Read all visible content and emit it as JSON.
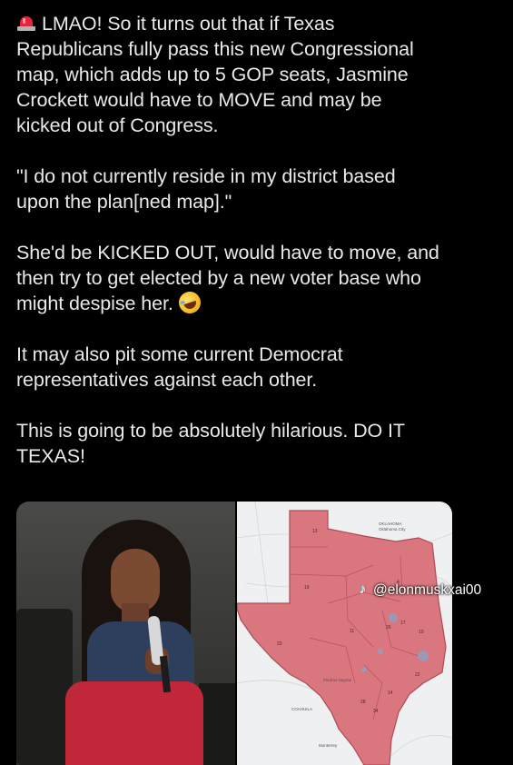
{
  "post": {
    "paragraphs": [
      "LMAO! So it turns out that if Texas Republicans fully pass this new Congressional map, which adds up to 5 GOP seats, Jasmine Crockett would have to MOVE and may be kicked out of Congress.",
      "\"I do not currently reside in my district based upon the plan[ned map].\"",
      "She'd be KICKED OUT, would have to move, and then try to get elected by a new voter base who might despise her.",
      "It may also pit some current Democrat representatives against each other.",
      "This is going to be absolutely hilarious. DO IT TEXAS!"
    ],
    "lines": {
      "p1": [
        "LMAO! So it turns out that if Texas",
        "Republicans fully pass this new Congressional",
        "map, which adds up to 5 GOP seats, Jasmine",
        "Crockett would have to MOVE and may be",
        "kicked out of Congress."
      ],
      "p2": [
        "\"I do not currently reside in my district based",
        "upon the plan[ned map].\""
      ],
      "p3": [
        "She'd be KICKED OUT, would have to move, and",
        "then try to get elected by a new voter base who",
        "might despise her."
      ],
      "p4": [
        "It may also pit some current Democrat",
        "representatives against each other."
      ],
      "p5": [
        "This is going to be absolutely hilarious. DO IT",
        "TEXAS!"
      ]
    },
    "leading_emoji": "police-light-icon",
    "trailing_emoji": "rolling-on-floor-laughing-icon"
  },
  "media": {
    "watermark": "@elonmuskxai00",
    "watermark_icon": "tiktok-icon",
    "map_labels": {
      "state_ok": "OKLAHOMA",
      "city_ok": "Oklahoma City",
      "districts": [
        "13",
        "19",
        "4",
        "11",
        "26",
        "17",
        "10",
        "23",
        "28",
        "22",
        "14",
        "34"
      ],
      "mexico": "COAHUILA",
      "monterrey": "Monterrey",
      "piedras": "Piedras Negras"
    },
    "colors": {
      "district_fill": "#d9767e",
      "district_stroke": "#b04a55",
      "map_bg": "#eef0f1"
    }
  }
}
